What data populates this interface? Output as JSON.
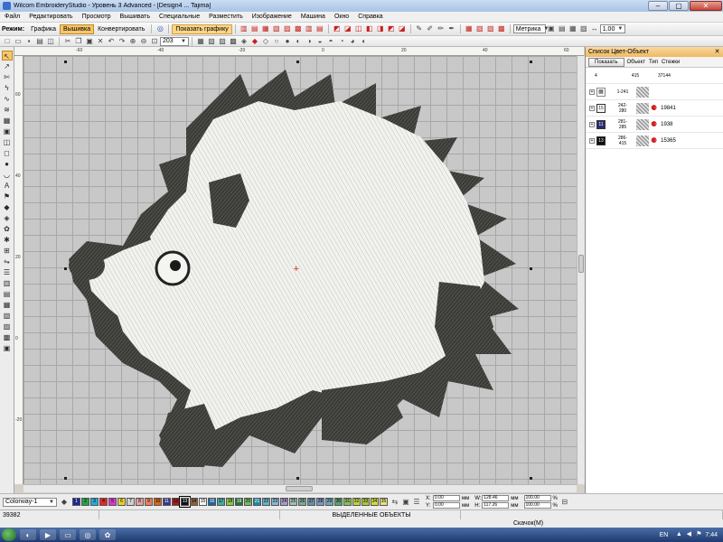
{
  "window": {
    "title": "Wilcom EmbroideryStudio - Уровень 3 Advanced - [Design4 ... Tajima]",
    "min_label": "–",
    "max_label": "▢",
    "close_label": "✕"
  },
  "menu": [
    "Файл",
    "Редактировать",
    "Просмотр",
    "Вышивать",
    "Специальные",
    "Разместить",
    "Изображение",
    "Машина",
    "Окно",
    "Справка"
  ],
  "toolbar": {
    "mode_label": "Режим:",
    "graphics_label": "Графика",
    "embroidery_label": "Вышивка",
    "convert_label": "Конвертировать",
    "show_graphics_label": "Показать графику",
    "units_value": "Метрика",
    "zoom_value": "203",
    "stitch_length_value": "1.00"
  },
  "panel": {
    "title": "Список Цвет-Объект",
    "show_button": "Показать",
    "col_object": "Объект",
    "col_type": "Тип",
    "col_stitches": "Стежки",
    "summary": {
      "count": "4",
      "range": "415",
      "stitches": "37144"
    },
    "rows": [
      {
        "swatch_label": "",
        "range_top": "1-241",
        "range_bottom": "",
        "stitches": "",
        "color": "#ffffff"
      },
      {
        "swatch_label": "15",
        "range_top": "242-",
        "range_bottom": "280",
        "stitches": "19841",
        "color": "#f4f4f4"
      },
      {
        "swatch_label": "11",
        "range_top": "281-",
        "range_bottom": "285",
        "stitches": "1938",
        "color": "#2c2c70"
      },
      {
        "swatch_label": "13",
        "range_top": "286-",
        "range_bottom": "415",
        "stitches": "15365",
        "color": "#101010"
      }
    ]
  },
  "colorbar": {
    "colorway": "Colorway-1",
    "swatches": [
      {
        "n": "1",
        "c": "#1c2a8c"
      },
      {
        "n": "2",
        "c": "#28a048"
      },
      {
        "n": "3",
        "c": "#2aa8d8"
      },
      {
        "n": "4",
        "c": "#e02828"
      },
      {
        "n": "5",
        "c": "#d838c8"
      },
      {
        "n": "6",
        "c": "#e8d030"
      },
      {
        "n": "7",
        "c": "#d0d0d0"
      },
      {
        "n": "8",
        "c": "#e8a0a0"
      },
      {
        "n": "9",
        "c": "#e88060"
      },
      {
        "n": "10",
        "c": "#d86818"
      },
      {
        "n": "11",
        "c": "#38388c"
      },
      {
        "n": "12",
        "c": "#a02020"
      },
      {
        "n": "13",
        "c": "#101010"
      },
      {
        "n": "14",
        "c": "#8c6038"
      },
      {
        "n": "15",
        "c": "#f4f4f4"
      },
      {
        "n": "16",
        "c": "#1c68a0"
      },
      {
        "n": "17",
        "c": "#48a8a0"
      },
      {
        "n": "18",
        "c": "#88c848"
      },
      {
        "n": "19",
        "c": "#2c7040"
      },
      {
        "n": "20",
        "c": "#78b868"
      },
      {
        "n": "21",
        "c": "#2088a0"
      },
      {
        "n": "22",
        "c": "#68b0c8"
      },
      {
        "n": "23",
        "c": "#88b8d0"
      },
      {
        "n": "24",
        "c": "#a898c8"
      },
      {
        "n": "25",
        "c": "#a0c0b0"
      },
      {
        "n": "26",
        "c": "#78a898"
      },
      {
        "n": "27",
        "c": "#6890a8"
      },
      {
        "n": "28",
        "c": "#7898c0"
      },
      {
        "n": "29",
        "c": "#68a8b8"
      },
      {
        "n": "30",
        "c": "#58a070"
      },
      {
        "n": "31",
        "c": "#88c058"
      },
      {
        "n": "32",
        "c": "#c0d048"
      },
      {
        "n": "33",
        "c": "#a8c838"
      },
      {
        "n": "34",
        "c": "#d0d838"
      },
      {
        "n": "35",
        "c": "#e8e080"
      }
    ],
    "x_label": "X:",
    "y_label": "Y:",
    "w_label": "W:",
    "h_label": "H:",
    "x_value": "0.00",
    "y_value": "0.00",
    "w_value": "128.46",
    "h_value": "117.26",
    "unit": "мм",
    "pct_w": "100.00",
    "pct_h": "100.00",
    "pct_unit": "%"
  },
  "status": {
    "stitch_count": "39382",
    "selected_objects": "ВЫДЕЛЕННЫЕ ОБЪЕКТЫ",
    "jump_label": "Скачок(М)"
  },
  "taskbar": {
    "lang": "EN",
    "time": "7:44"
  }
}
